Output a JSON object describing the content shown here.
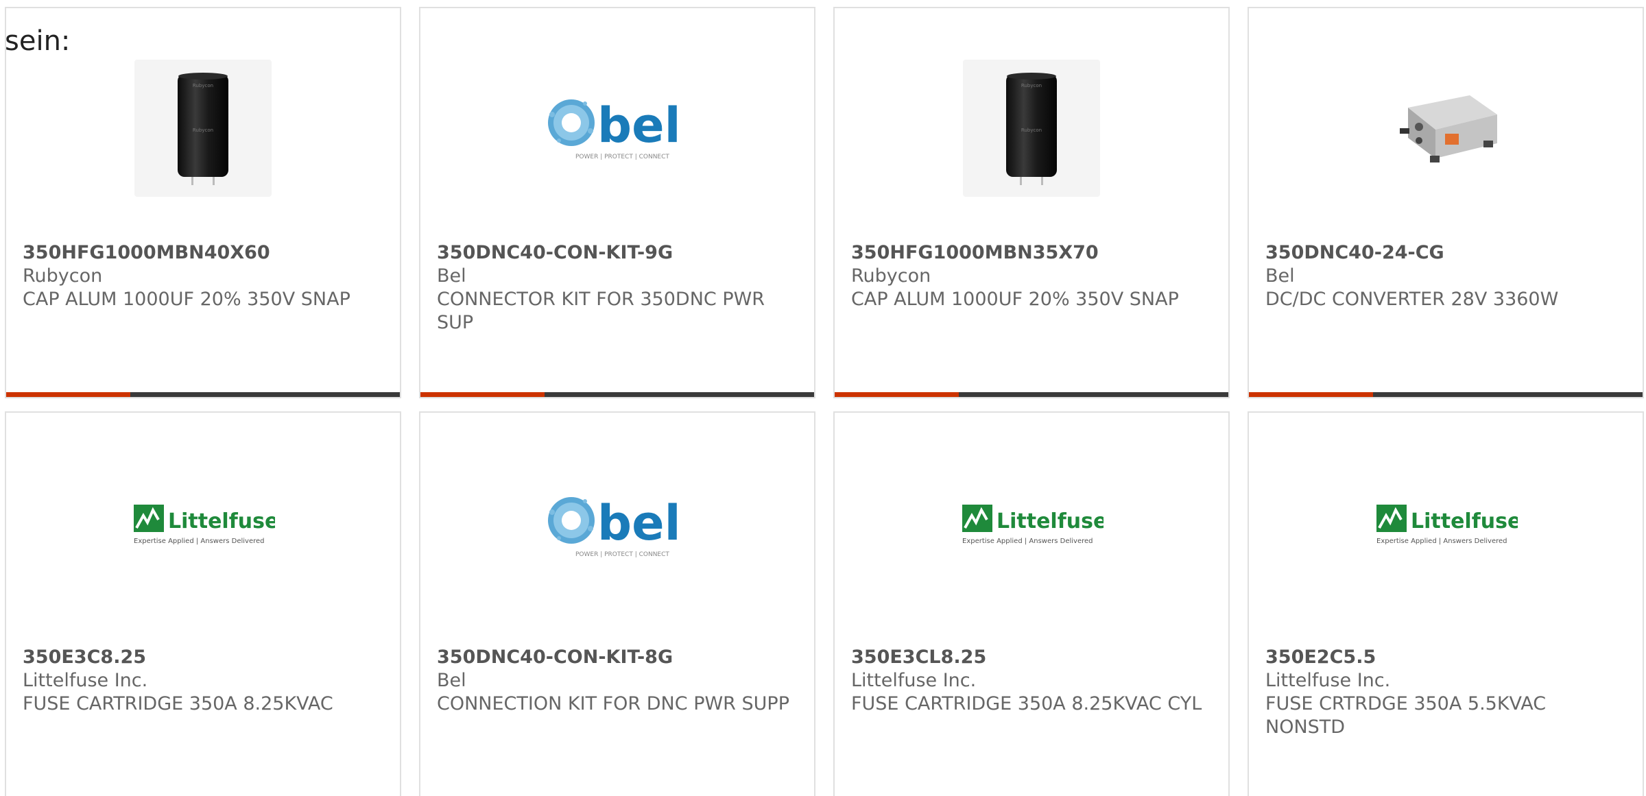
{
  "intro_text": "sein:",
  "accent_color": "#cc3300",
  "bar_color": "#3a3a3a",
  "products": [
    {
      "part_number": "350HFG1000MBN40X60",
      "manufacturer": "Rubycon",
      "description": "CAP ALUM 1000UF 20% 350V SNAP",
      "image": "capacitor-image"
    },
    {
      "part_number": "350DNC40-CON-KIT-9G",
      "manufacturer": "Bel",
      "description": "CONNECTOR KIT FOR 350DNC PWR SUP",
      "image": "bel-logo",
      "logo_text": "bel",
      "logo_tagline": "POWER | PROTECT | CONNECT"
    },
    {
      "part_number": "350HFG1000MBN35X70",
      "manufacturer": "Rubycon",
      "description": "CAP ALUM 1000UF 20% 350V SNAP",
      "image": "capacitor-image"
    },
    {
      "part_number": "350DNC40-24-CG",
      "manufacturer": "Bel",
      "description": "DC/DC CONVERTER 28V 3360W",
      "image": "converter-image"
    },
    {
      "part_number": "350E3C8.25",
      "manufacturer": "Littelfuse Inc.",
      "description": "FUSE CARTRIDGE 350A 8.25KVAC",
      "image": "littelfuse-logo",
      "logo_text": "Littelfuse",
      "logo_tagline": "Expertise Applied | Answers Delivered"
    },
    {
      "part_number": "350DNC40-CON-KIT-8G",
      "manufacturer": "Bel",
      "description": "CONNECTION KIT FOR DNC PWR SUPP",
      "image": "bel-logo",
      "logo_text": "bel",
      "logo_tagline": "POWER | PROTECT | CONNECT"
    },
    {
      "part_number": "350E3CL8.25",
      "manufacturer": "Littelfuse Inc.",
      "description": "FUSE CARTRIDGE 350A 8.25KVAC CYL",
      "image": "littelfuse-logo",
      "logo_text": "Littelfuse",
      "logo_tagline": "Expertise Applied | Answers Delivered"
    },
    {
      "part_number": "350E2C5.5",
      "manufacturer": "Littelfuse Inc.",
      "description": "FUSE CRTRDGE 350A 5.5KVAC NONSTD",
      "image": "littelfuse-logo",
      "logo_text": "Littelfuse",
      "logo_tagline": "Expertise Applied | Answers Delivered"
    }
  ]
}
